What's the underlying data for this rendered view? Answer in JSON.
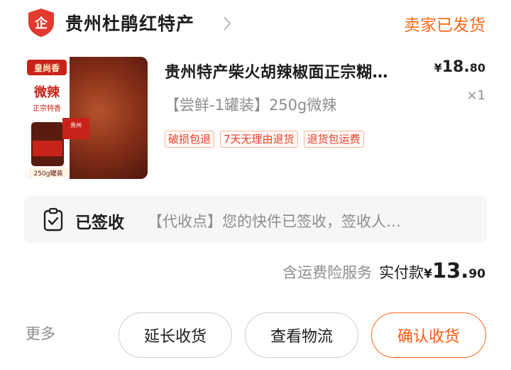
{
  "store": {
    "logo_text": "企",
    "name": "贵州杜鹃红特产",
    "status": "卖家已发货"
  },
  "product": {
    "image_brand": "皇尚香",
    "image_tagline_1": "微辣",
    "image_tagline_2": "正宗特香",
    "image_region": "贵州",
    "image_weight": "250g罐装",
    "title": "贵州特产柴火胡辣椒面正宗糊…",
    "variant": "【尝鲜-1罐装】250g微辣",
    "price_currency": "¥",
    "price_int": "18.",
    "price_dec": "80",
    "quantity": "×1",
    "tags": [
      "破损包退",
      "7天无理由退货",
      "退货包运费"
    ]
  },
  "logistics": {
    "status": "已签收",
    "detail": "【代收点】您的快件已签收，签收人…"
  },
  "payment": {
    "service": "含运费险服务",
    "label": "实付款",
    "currency": "¥",
    "amount_int": "13.",
    "amount_dec": "90"
  },
  "actions": {
    "more": "更多",
    "extend": "延长收货",
    "view_logistics": "查看物流",
    "confirm": "确认收货"
  },
  "colors": {
    "accent": "#ff6a1a",
    "tag_red": "#e8402a",
    "logo_red": "#e23a2e"
  },
  "icons": {
    "store_logo": "store-badge-icon",
    "store_arrow": "chevron-right-icon",
    "logistics": "clipboard-check-icon"
  }
}
